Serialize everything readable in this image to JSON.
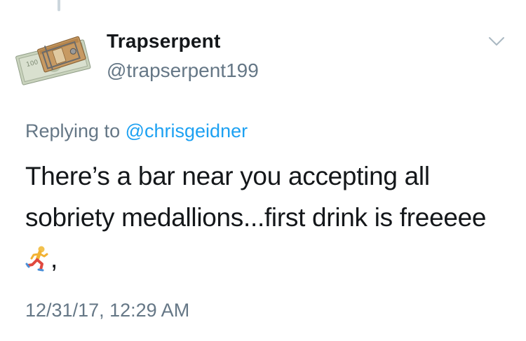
{
  "tweet": {
    "user": {
      "display_name": "Trapserpent",
      "handle": "@trapserpent199",
      "avatar_icon": "money-mousetrap-avatar"
    },
    "replying_prefix": "Replying to",
    "replying_to": "@chrisgeidner",
    "text_before_emoji": "There’s a bar near you accepting all sobriety medallions...first drink is freeeee",
    "emoji_icon": "runner-icon",
    "text_after_emoji": ",",
    "timestamp": "12/31/17, 12:29 AM"
  },
  "colors": {
    "name_text": "#14171a",
    "secondary_text": "#657786",
    "mention": "#1da1f2",
    "thread_line": "#ccd6dd"
  }
}
